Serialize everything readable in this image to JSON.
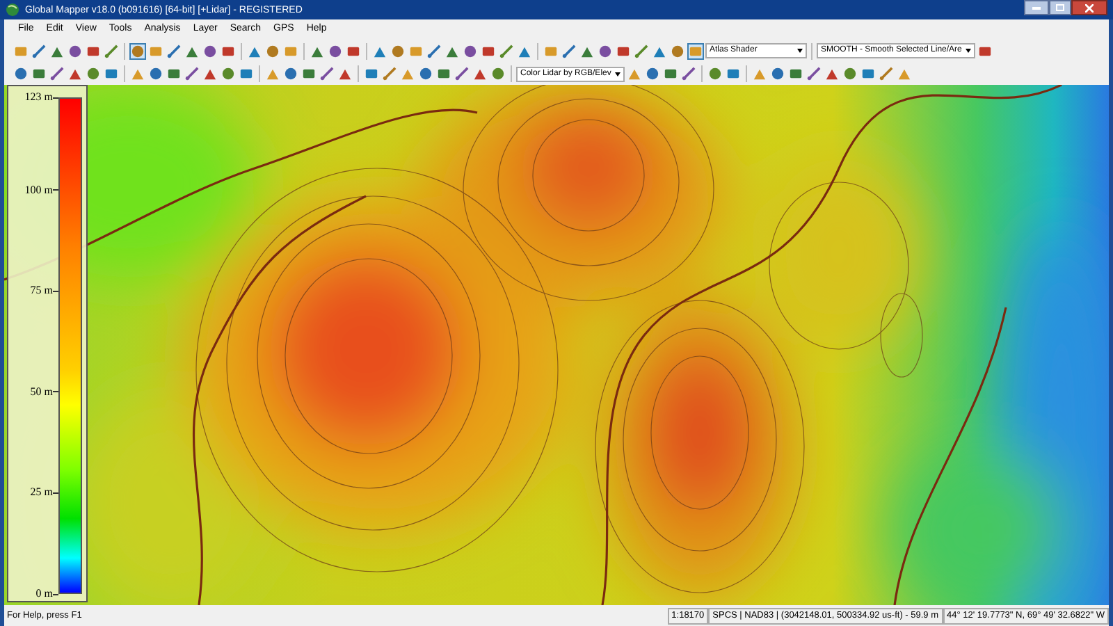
{
  "window": {
    "title": "Global Mapper v18.0 (b091616) [64-bit] [+Lidar] - REGISTERED"
  },
  "menu": [
    "File",
    "Edit",
    "View",
    "Tools",
    "Analysis",
    "Layer",
    "Search",
    "GPS",
    "Help"
  ],
  "toolbar_1": [
    {
      "kind": "button",
      "selected": false
    },
    {
      "kind": "button",
      "selected": false
    },
    {
      "kind": "button",
      "selected": false
    },
    {
      "kind": "button",
      "selected": false
    },
    {
      "kind": "button",
      "selected": false
    },
    {
      "kind": "button",
      "selected": false
    },
    {
      "kind": "separator"
    },
    {
      "kind": "button",
      "selected": true
    },
    {
      "kind": "button",
      "selected": false
    },
    {
      "kind": "button",
      "selected": false
    },
    {
      "kind": "button",
      "selected": false
    },
    {
      "kind": "button",
      "selected": false
    },
    {
      "kind": "button",
      "selected": false
    },
    {
      "kind": "separator"
    },
    {
      "kind": "button",
      "selected": false
    },
    {
      "kind": "button",
      "selected": false
    },
    {
      "kind": "button",
      "selected": false
    },
    {
      "kind": "separator"
    },
    {
      "kind": "button",
      "selected": false
    },
    {
      "kind": "button",
      "selected": false
    },
    {
      "kind": "button",
      "selected": false
    },
    {
      "kind": "separator"
    },
    {
      "kind": "button",
      "selected": false
    },
    {
      "kind": "button",
      "selected": false
    },
    {
      "kind": "button",
      "selected": false
    },
    {
      "kind": "button",
      "selected": false
    },
    {
      "kind": "button",
      "selected": false
    },
    {
      "kind": "button",
      "selected": false
    },
    {
      "kind": "button",
      "selected": false
    },
    {
      "kind": "button",
      "selected": false
    },
    {
      "kind": "button",
      "selected": false
    },
    {
      "kind": "separator"
    },
    {
      "kind": "button",
      "selected": false
    },
    {
      "kind": "button",
      "selected": false
    },
    {
      "kind": "button",
      "selected": false
    },
    {
      "kind": "button",
      "selected": false
    },
    {
      "kind": "button",
      "selected": false
    },
    {
      "kind": "button",
      "selected": false
    },
    {
      "kind": "button",
      "selected": false
    },
    {
      "kind": "button",
      "selected": false
    },
    {
      "kind": "button",
      "selected": true
    },
    {
      "kind": "dropdown",
      "value": "Atlas Shader"
    },
    {
      "kind": "separator"
    },
    {
      "kind": "dropdown",
      "value": "SMOOTH - Smooth Selected Line/Are"
    },
    {
      "kind": "button",
      "selected": false
    }
  ],
  "toolbar_2": [
    {
      "kind": "button",
      "selected": false
    },
    {
      "kind": "button",
      "selected": false
    },
    {
      "kind": "button",
      "selected": false
    },
    {
      "kind": "button",
      "selected": false
    },
    {
      "kind": "button",
      "selected": false
    },
    {
      "kind": "button",
      "selected": false
    },
    {
      "kind": "separator"
    },
    {
      "kind": "button",
      "selected": false
    },
    {
      "kind": "button",
      "selected": false
    },
    {
      "kind": "button",
      "selected": false
    },
    {
      "kind": "button",
      "selected": false
    },
    {
      "kind": "button",
      "selected": false
    },
    {
      "kind": "button",
      "selected": false
    },
    {
      "kind": "button",
      "selected": false
    },
    {
      "kind": "separator"
    },
    {
      "kind": "button",
      "selected": false
    },
    {
      "kind": "button",
      "selected": false
    },
    {
      "kind": "button",
      "selected": false
    },
    {
      "kind": "button",
      "selected": false
    },
    {
      "kind": "button",
      "selected": false
    },
    {
      "kind": "separator"
    },
    {
      "kind": "button",
      "selected": false
    },
    {
      "kind": "button",
      "selected": false
    },
    {
      "kind": "button",
      "selected": false
    },
    {
      "kind": "button",
      "selected": false
    },
    {
      "kind": "button",
      "selected": false
    },
    {
      "kind": "button",
      "selected": false
    },
    {
      "kind": "button",
      "selected": false
    },
    {
      "kind": "button",
      "selected": false
    },
    {
      "kind": "separator"
    },
    {
      "kind": "dropdown",
      "value": "Color Lidar by RGB/Elev"
    },
    {
      "kind": "button",
      "selected": false
    },
    {
      "kind": "button",
      "selected": false
    },
    {
      "kind": "button",
      "selected": false
    },
    {
      "kind": "button",
      "selected": false
    },
    {
      "kind": "separator"
    },
    {
      "kind": "button",
      "selected": false
    },
    {
      "kind": "button",
      "selected": false
    },
    {
      "kind": "separator"
    },
    {
      "kind": "button",
      "selected": false
    },
    {
      "kind": "button",
      "selected": false
    },
    {
      "kind": "button",
      "selected": false
    },
    {
      "kind": "button",
      "selected": false
    },
    {
      "kind": "button",
      "selected": false
    },
    {
      "kind": "button",
      "selected": false
    },
    {
      "kind": "button",
      "selected": false
    },
    {
      "kind": "button",
      "selected": false
    },
    {
      "kind": "button",
      "selected": false
    }
  ],
  "legend": {
    "ticks": [
      "123 m",
      "100 m",
      "75 m",
      "50 m",
      "25 m",
      "0 m"
    ]
  },
  "status_bar": {
    "help": "For Help, press F1",
    "scale": "1:18170",
    "projection": "SPCS | NAD83 | (3042148.01, 500334.92 us-ft) - 59.9 m",
    "coordinates": "44° 12' 19.7773\" N, 69° 49' 32.6822\" W"
  }
}
